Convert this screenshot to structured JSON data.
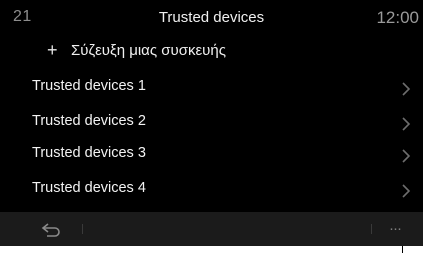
{
  "status": {
    "temperature": "21",
    "title": "Trusted devices",
    "time": "12:00"
  },
  "pair": {
    "icon": "plus-icon",
    "label": "Σύζευξη μιας συσκευής"
  },
  "devices": [
    {
      "label": "Trusted devices 1"
    },
    {
      "label": "Trusted devices 2"
    },
    {
      "label": "Trusted devices 3"
    },
    {
      "label": "Trusted devices 4"
    }
  ],
  "bottombar": {
    "back_icon": "back-icon",
    "more_label": "···"
  },
  "colors": {
    "background": "#000000",
    "bottombar": "#1b1b1b",
    "text": "#f0f0f0",
    "muted": "#8d8d8d"
  }
}
